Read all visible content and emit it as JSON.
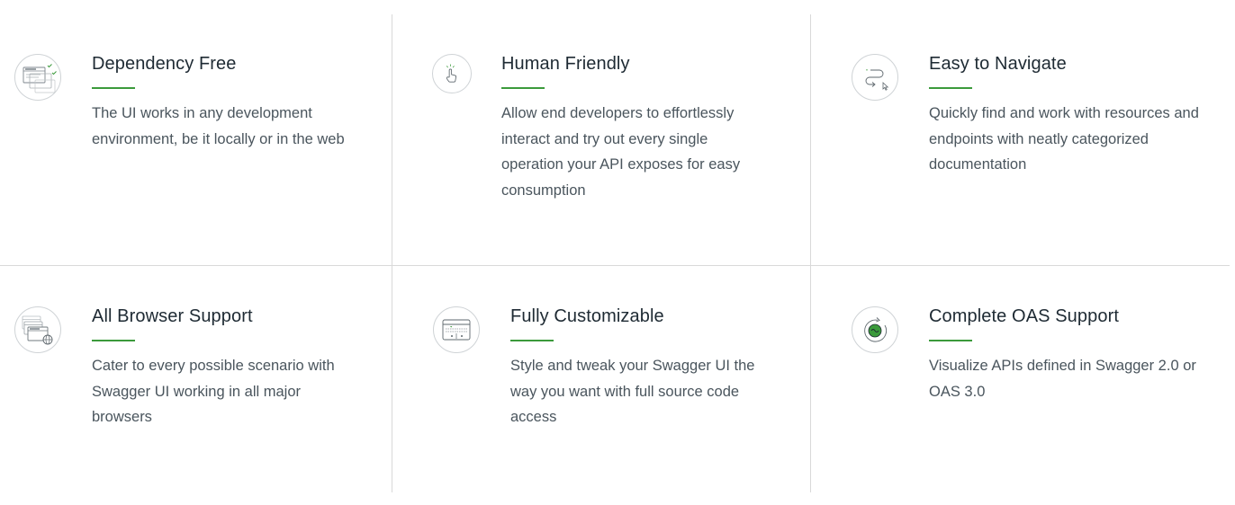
{
  "features": [
    {
      "icon": "dependency-free-icon",
      "title": "Dependency Free",
      "description": "The UI works in any development environment, be it locally or in the web"
    },
    {
      "icon": "human-friendly-icon",
      "title": "Human Friendly",
      "description": "Allow end developers to effortlessly interact and try out every single operation your API exposes for easy consumption"
    },
    {
      "icon": "easy-navigate-icon",
      "title": "Easy to Navigate",
      "description": "Quickly find and work with resources and endpoints with neatly categorized documentation"
    },
    {
      "icon": "all-browser-support-icon",
      "title": "All Browser Support",
      "description": "Cater to every possible scenario with Swagger UI working in all major browsers"
    },
    {
      "icon": "fully-customizable-icon",
      "title": "Fully Customizable",
      "description": "Style and tweak your Swagger UI the way you want with full source code access"
    },
    {
      "icon": "complete-oas-support-icon",
      "title": "Complete OAS Support",
      "description": "Visualize APIs defined in Swagger 2.0 or OAS 3.0"
    }
  ],
  "colors": {
    "accent": "#3b9a3b",
    "title": "#1e2a33",
    "text": "#4a555d",
    "divider": "#d9d9d9"
  }
}
